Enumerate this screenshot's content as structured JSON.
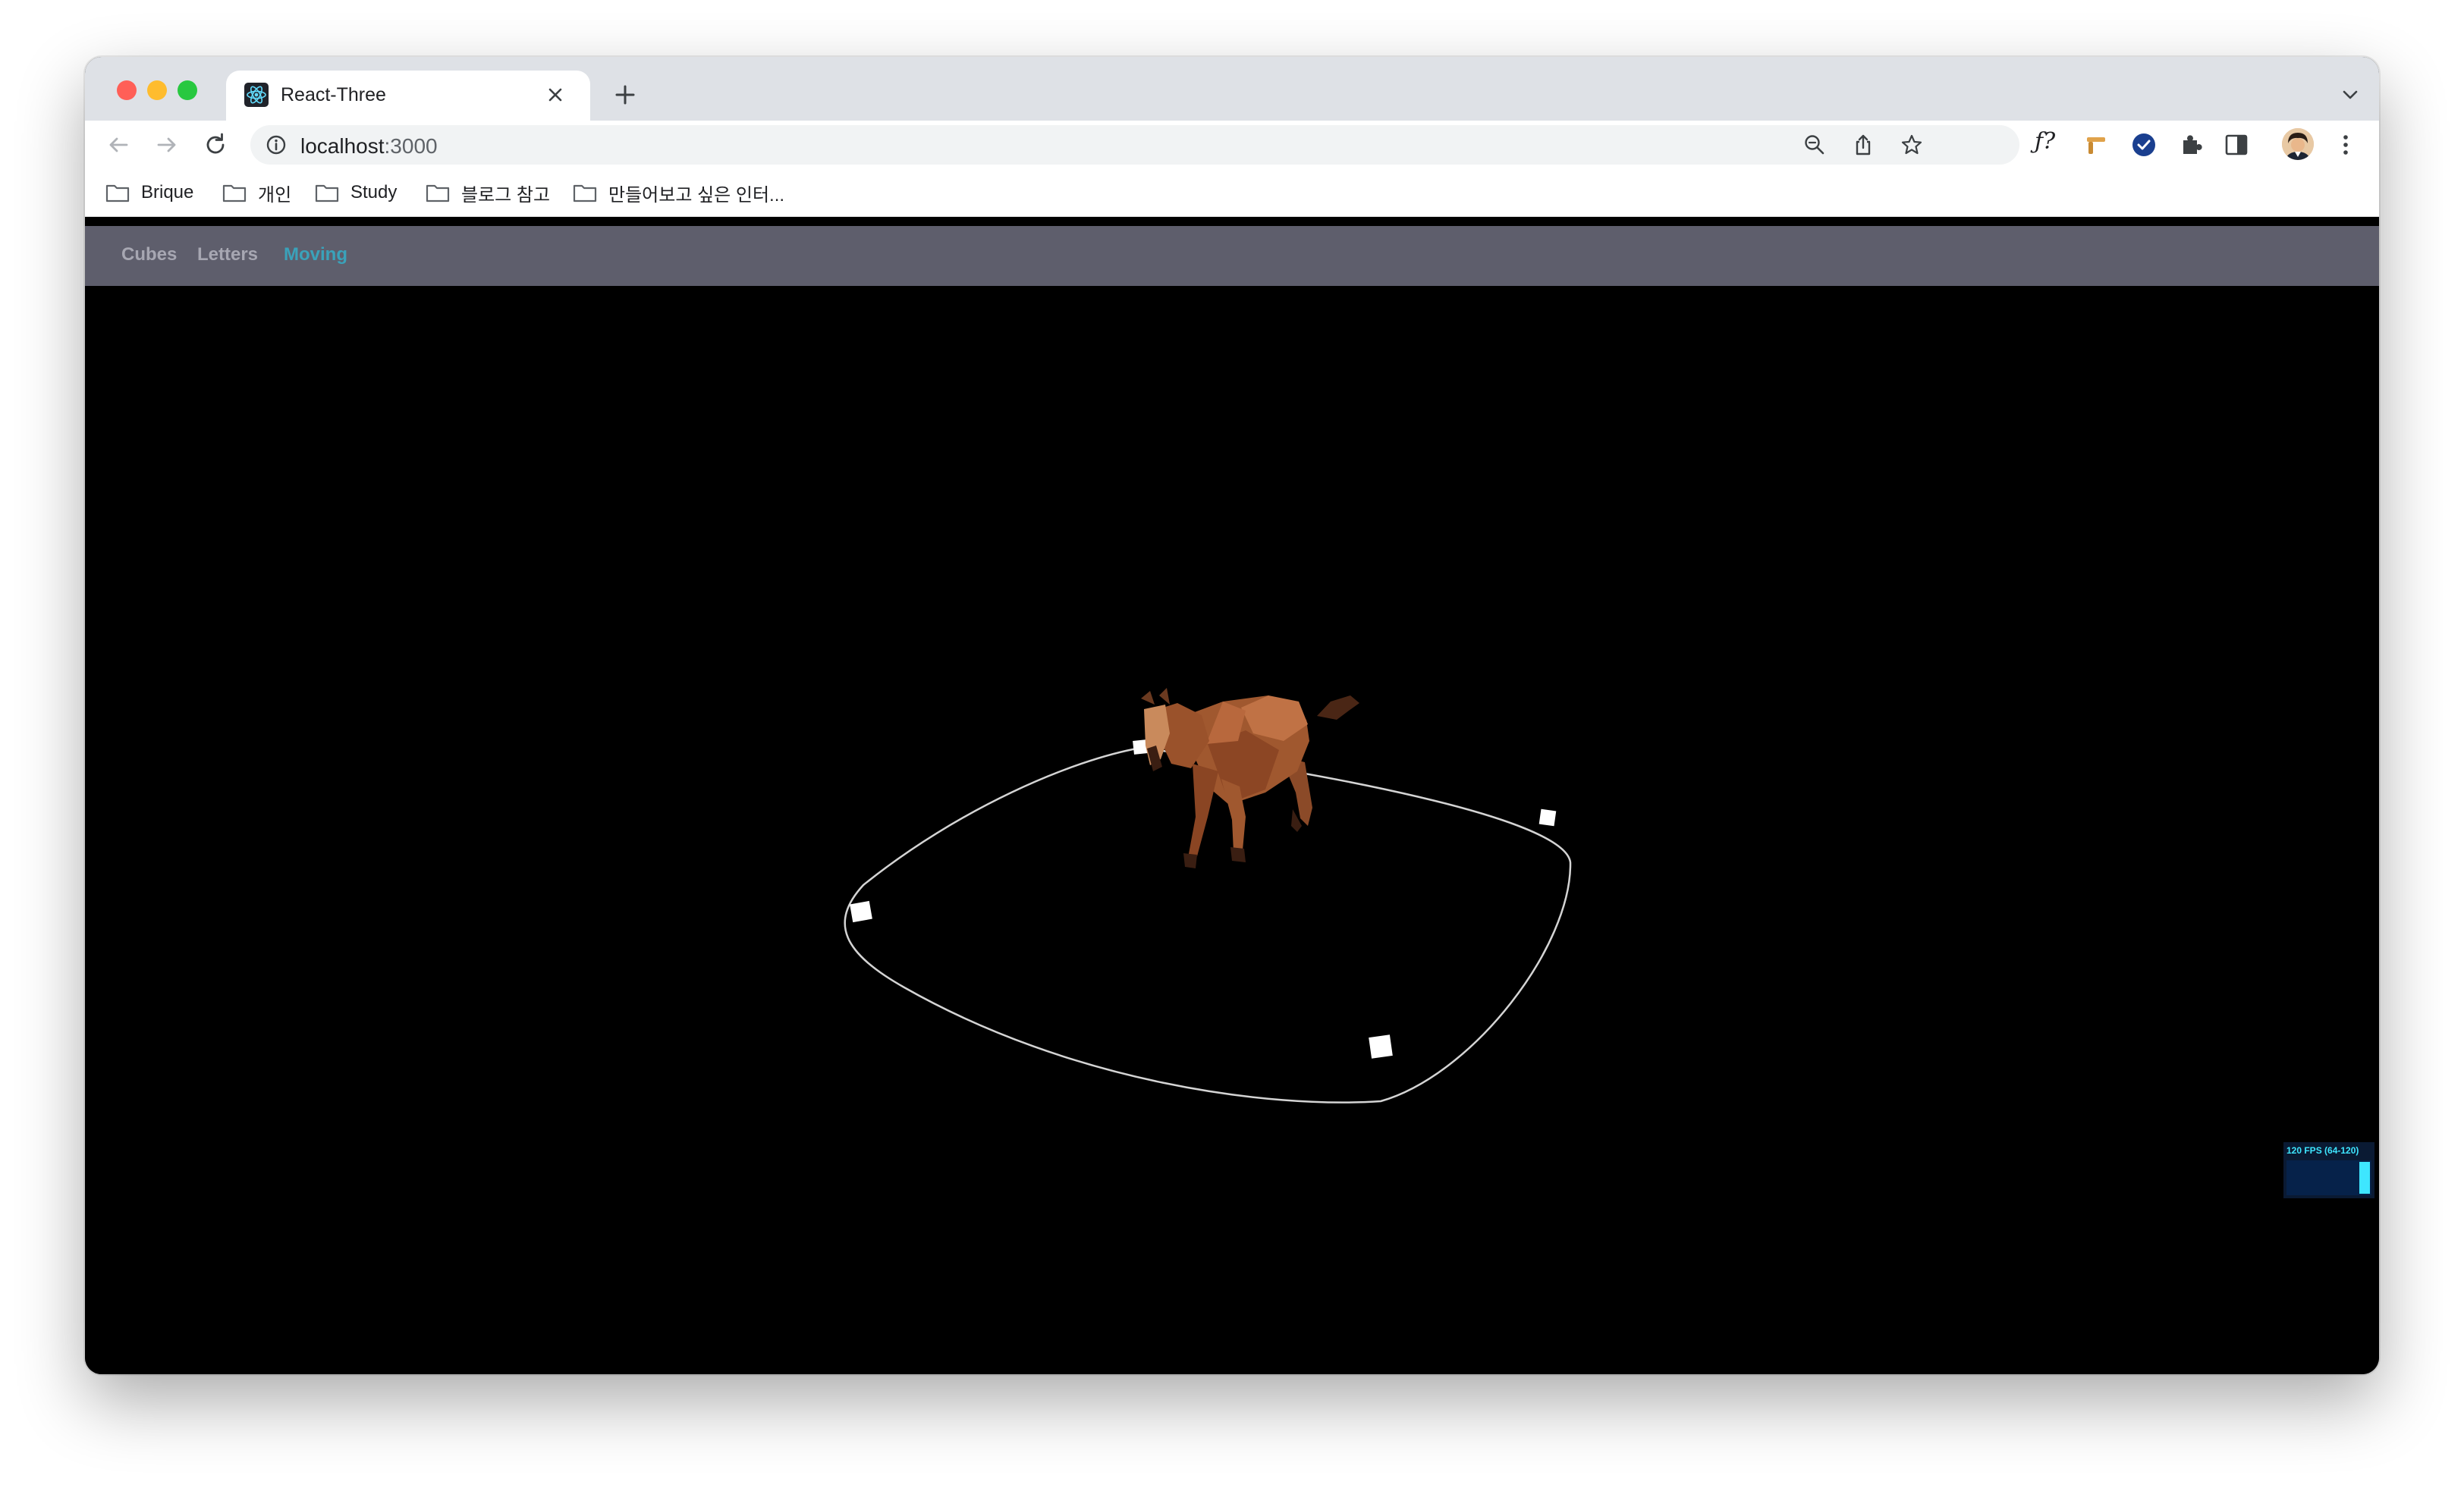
{
  "browser": {
    "tab_title": "React-Three",
    "url_host": "localhost",
    "url_port": ":3000",
    "bookmarks": [
      "Brique",
      "개인",
      "Study",
      "블로그 참고",
      "만들어보고 싶은 인터..."
    ]
  },
  "app": {
    "nav": [
      "Cubes",
      "Letters",
      "Moving"
    ],
    "active_nav": "Moving"
  },
  "stats": {
    "fps_label": "120 FPS (64-120)",
    "fps": 120,
    "fps_min": 64,
    "fps_max": 120
  },
  "colors": {
    "nav_bg": "#5e5e6c",
    "nav_link": "#a7a7b2",
    "nav_active": "#3aa2ba",
    "canvas_bg": "#000000",
    "horse": "#a8623a",
    "path": "#d9d9d9",
    "stats_text": "#3ee6ff"
  },
  "icons": [
    "react-favicon",
    "close-icon",
    "plus-icon",
    "back-icon",
    "forward-icon",
    "reload-icon",
    "info-icon",
    "zoom-icon",
    "share-icon",
    "star-icon",
    "fq-extension-icon",
    "pipe-extension-icon",
    "check-extension-icon",
    "puzzle-icon",
    "sidepanel-icon",
    "avatar",
    "kebab-menu-icon",
    "folder-icon",
    "chevron-down-icon"
  ]
}
